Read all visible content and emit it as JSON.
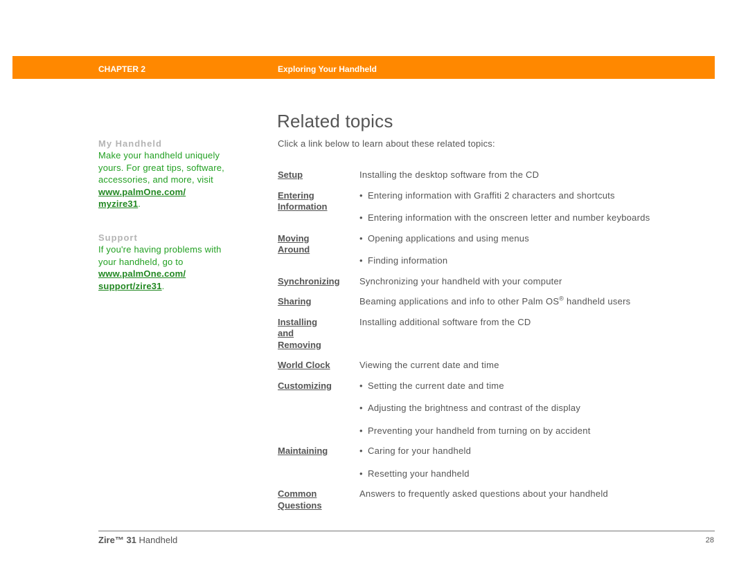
{
  "header": {
    "chapter": "CHAPTER 2",
    "title": "Exploring Your Handheld",
    "bar_color": "#ff8800"
  },
  "sidebar": {
    "blocks": [
      {
        "heading": "My Handheld",
        "text": "Make your handheld uniquely yours. For great tips, software, accessories, and more, visit",
        "link": "www.palmOne.com/ myzire31",
        "suffix": "."
      },
      {
        "heading": "Support",
        "text": "If you're having problems with your handheld, go to",
        "link": "www.palmOne.com/ support/zire31",
        "suffix": "."
      }
    ],
    "text_color": "#22a022"
  },
  "main": {
    "title": "Related topics",
    "intro": "Click a link below to learn about these related topics:",
    "topics": [
      {
        "link": "Setup",
        "items": [
          "Installing the desktop software from the CD"
        ],
        "bulleted": false
      },
      {
        "link": "Entering Information",
        "items": [
          "Entering information with Graffiti 2 characters and shortcuts",
          "Entering information with the onscreen letter and number keyboards"
        ],
        "bulleted": true
      },
      {
        "link": "Moving Around",
        "items": [
          "Opening applications and using menus",
          "Finding information"
        ],
        "bulleted": true
      },
      {
        "link": "Synchronizing",
        "items": [
          "Synchronizing your handheld with your computer"
        ],
        "bulleted": false
      },
      {
        "link": "Sharing",
        "items": [
          "Beaming applications and info to other Palm OS® handheld users"
        ],
        "bulleted": false
      },
      {
        "link": "Installing and Removing",
        "items": [
          "Installing additional software from the CD"
        ],
        "bulleted": false
      },
      {
        "link": "World Clock",
        "items": [
          "Viewing the current date and time"
        ],
        "bulleted": false
      },
      {
        "link": "Customizing",
        "items": [
          "Setting the current date and time",
          "Adjusting the brightness and contrast of the display",
          "Preventing your handheld from turning on by accident"
        ],
        "bulleted": true
      },
      {
        "link": "Maintaining",
        "items": [
          "Caring for your handheld",
          "Resetting your handheld"
        ],
        "bulleted": true
      },
      {
        "link": "Common Questions",
        "items": [
          "Answers to frequently asked questions about your handheld"
        ],
        "bulleted": false
      }
    ]
  },
  "footer": {
    "product_bold": "Zire™ 31",
    "product_rest": " Handheld",
    "page_number": "28"
  }
}
